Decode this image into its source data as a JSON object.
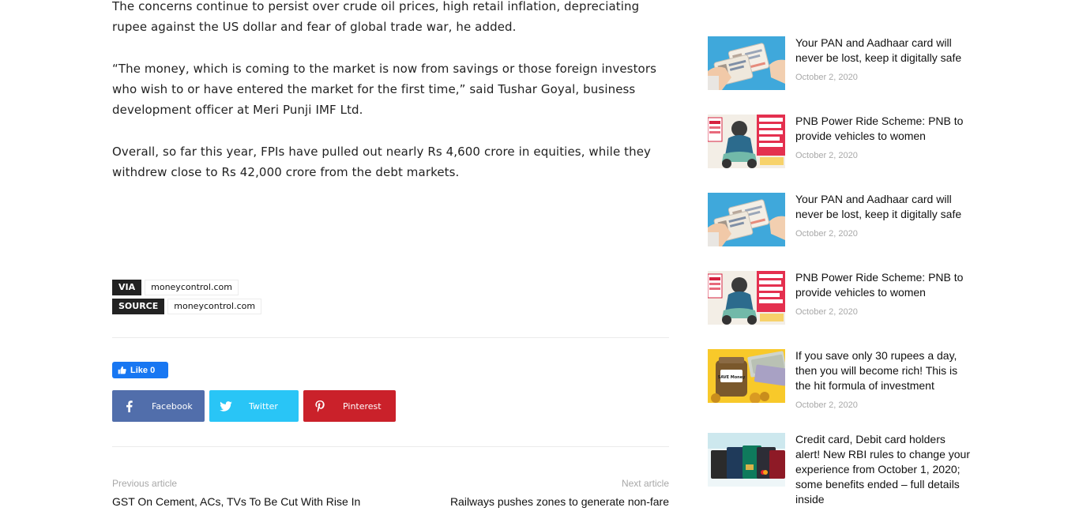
{
  "article": {
    "paragraphs": [
      "The concerns continue to persist over crude oil prices, high retail inflation, depreciating rupee against the US dollar and fear of global trade war, he added.",
      "“The money, which is coming to the market is now from savings or those foreign investors who wish to or have entered the market for the first time,” said Tushar Goyal, business development officer at Meri Punji IMF Ltd.",
      "Overall, so far this year, FPIs have pulled out nearly Rs 4,600 crore in equities, while they withdrew close to Rs 42,000 crore from the debt markets."
    ],
    "via": {
      "label": "VIA",
      "value": "moneycontrol.com"
    },
    "source": {
      "label": "SOURCE",
      "value": "moneycontrol.com"
    }
  },
  "social": {
    "like_label": "Like 0",
    "buttons": [
      {
        "label": "Facebook",
        "icon": "facebook-icon",
        "color": "#516eab"
      },
      {
        "label": "Twitter",
        "icon": "twitter-icon",
        "color": "#29c5f6"
      },
      {
        "label": "Pinterest",
        "icon": "pinterest-icon",
        "color": "#ca212a"
      }
    ]
  },
  "navigation": {
    "previous_label": "Previous article",
    "previous_title": "GST On Cement, ACs, TVs To Be Cut With Rise In",
    "next_label": "Next article",
    "next_title": "Railways pushes zones to generate non-fare"
  },
  "sidebar": {
    "posts": [
      {
        "title": "Your PAN and Aadhaar card will never be lost, keep it digitally safe",
        "date": "October 2, 2020",
        "thumb": "pan-aadhaar-card-image"
      },
      {
        "title": "PNB Power Ride Scheme: PNB to provide vehicles to women",
        "date": "October 2, 2020",
        "thumb": "pnb-power-ride-image"
      },
      {
        "title": "Your PAN and Aadhaar card will never be lost, keep it digitally safe",
        "date": "October 2, 2020",
        "thumb": "pan-aadhaar-card-image"
      },
      {
        "title": "PNB Power Ride Scheme: PNB to provide vehicles to women",
        "date": "October 2, 2020",
        "thumb": "pnb-power-ride-image"
      },
      {
        "title": "If you save only 30 rupees a day, then you will become rich! This is the hit formula of investment",
        "date": "October 2, 2020",
        "thumb": "save-money-jar-image",
        "thumb_text": "SAVE Money"
      },
      {
        "title": "Credit card, Debit card holders alert! New RBI rules to change your experience from October 1, 2020; some benefits ended – full details inside",
        "date": "",
        "thumb": "credit-cards-image"
      }
    ]
  }
}
